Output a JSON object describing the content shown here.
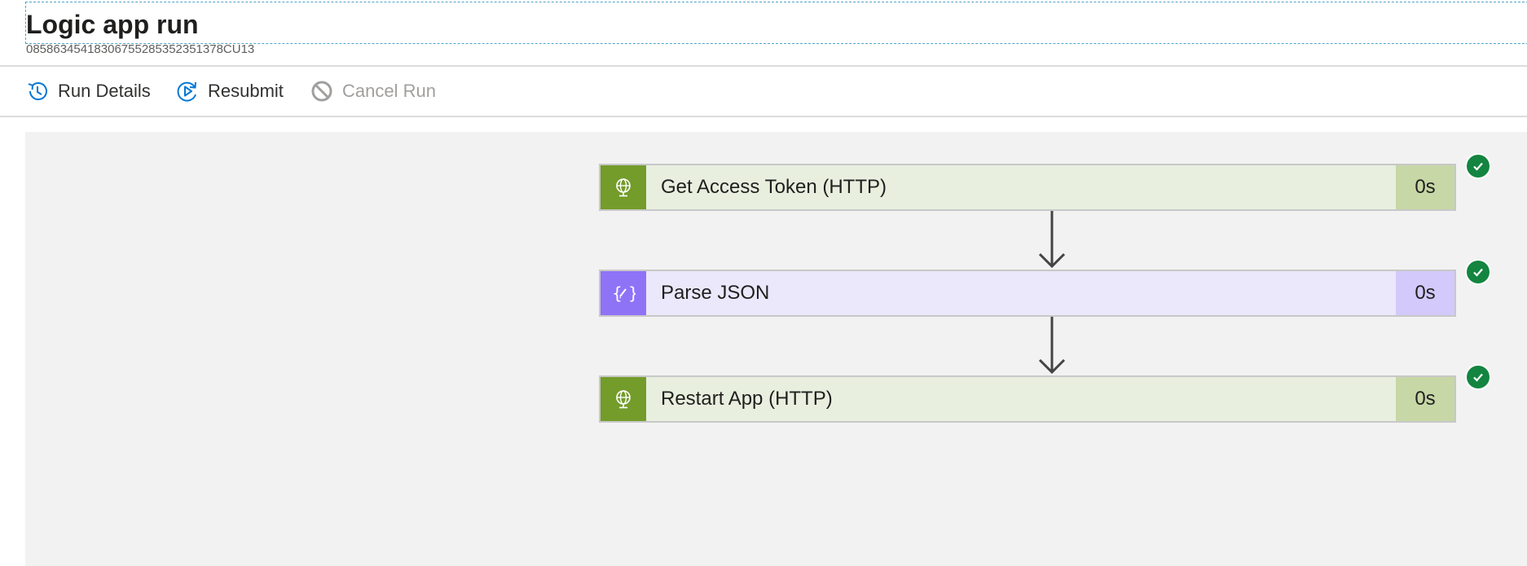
{
  "header": {
    "title": "Logic app run",
    "run_id": "08586345418306755285352351378CU13"
  },
  "toolbar": {
    "run_details_label": "Run Details",
    "resubmit_label": "Resubmit",
    "cancel_run_label": "Cancel Run"
  },
  "workflow": {
    "actions": [
      {
        "label": "Get Access Token (HTTP)",
        "duration": "0s",
        "status": "succeeded",
        "icon": "http-globe-icon"
      },
      {
        "label": "Parse JSON",
        "duration": "0s",
        "status": "succeeded",
        "icon": "parse-json-icon"
      },
      {
        "label": "Restart App (HTTP)",
        "duration": "0s",
        "status": "succeeded",
        "icon": "http-globe-icon"
      }
    ]
  },
  "colors": {
    "accent": "#0078d4",
    "http_icon_bg": "#739c2b",
    "http_body_bg": "#e8efdf",
    "http_duration_bg": "#c7d7a6",
    "json_icon_bg": "#8f73f7",
    "json_body_bg": "#ebe8fb",
    "json_duration_bg": "#d3c9fb",
    "success": "#138540",
    "canvas_bg": "#f2f2f2"
  }
}
